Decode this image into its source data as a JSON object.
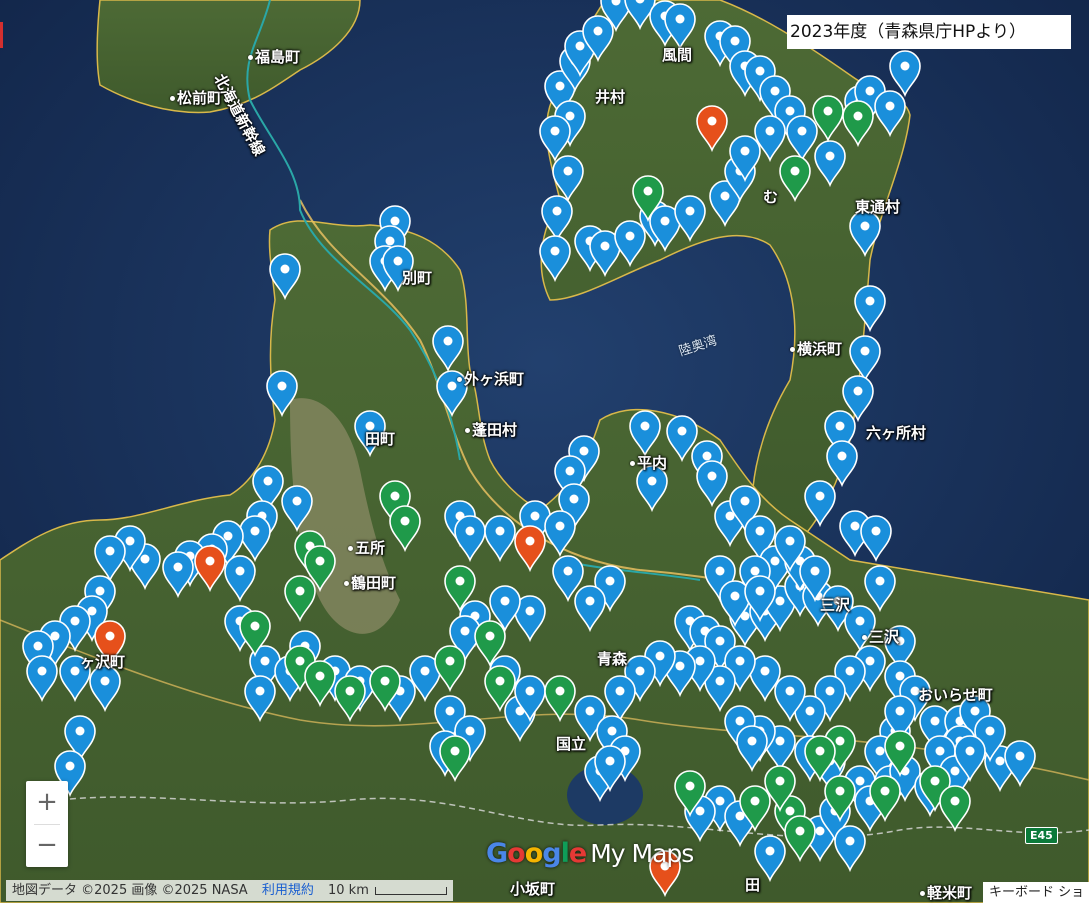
{
  "map": {
    "layer_title": "2023年度（青森県庁HPより）",
    "labels": {
      "fukushima": "福島町",
      "matsumae": "松前町",
      "shinkansen": "北海道新幹線",
      "kazama": "風間",
      "oi": "井村",
      "hiranai": "平内",
      "mutsu": "む",
      "higashidori": "東通村",
      "sotogahama": "外ヶ浜町",
      "yomogita": "蓬田村",
      "mutsu_bay": "陸奥湾",
      "yokohama": "横浜町",
      "rokkasho": "六ヶ所村",
      "nakadomari": "田町",
      "imabetsu": "別町",
      "goshogawara": "五所",
      "tsuruta": "鶴田町",
      "ajigasawa": "ヶ沢町",
      "aomori": "青森",
      "misawa": "三沢",
      "oirase": "おいらせ町",
      "kokuritsu": "国立",
      "kosaka": "小坂町",
      "karumai": "軽米町",
      "tanbe": "田",
      "highway": "E45"
    },
    "markers": {
      "blue_color": "#1a8fdb",
      "green_color": "#1f9a4a",
      "orange_color": "#e6501b"
    },
    "zoom_in": "+",
    "zoom_out": "−",
    "brand": {
      "g1": "G",
      "g2": "o",
      "g3": "o",
      "g4": "g",
      "g5": "l",
      "g6": "e",
      "mymaps": "My Maps"
    },
    "attribution": "地図データ ©2025 画像 ©2025 NASA",
    "terms": "利用規約",
    "scale": "10 km",
    "keyboard": "キーボード ショ"
  }
}
